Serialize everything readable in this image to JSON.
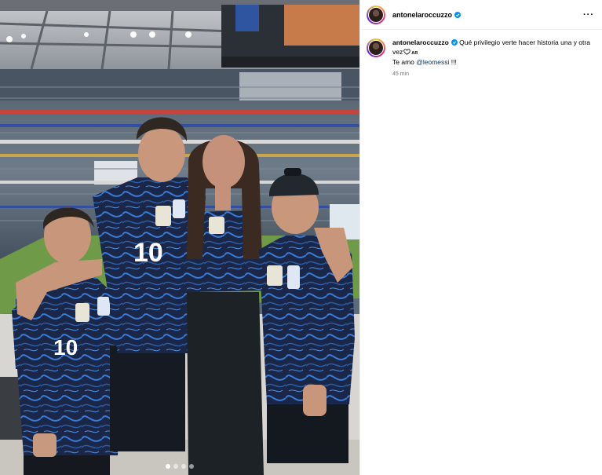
{
  "post": {
    "author": {
      "username": "antonelaroccuzzo",
      "verified": true
    },
    "menu_icon": "more-horizontal-icon",
    "caption": {
      "text_line1": "Qué privilegio verte hacer historia una y otra vez",
      "flag_code": "AR",
      "text_line2_prefix": "Te amo ",
      "mention": "@leomessi",
      "text_line2_suffix": " !!!"
    },
    "timestamp": "45 min",
    "media": {
      "description_icon": "photo",
      "carousel_dots": 4,
      "active_dot": 0
    }
  },
  "colors": {
    "jersey": "#1a2748",
    "jersey_pattern": "#3a7bd5",
    "verified": "#0095f6",
    "mention": "#00376b"
  }
}
